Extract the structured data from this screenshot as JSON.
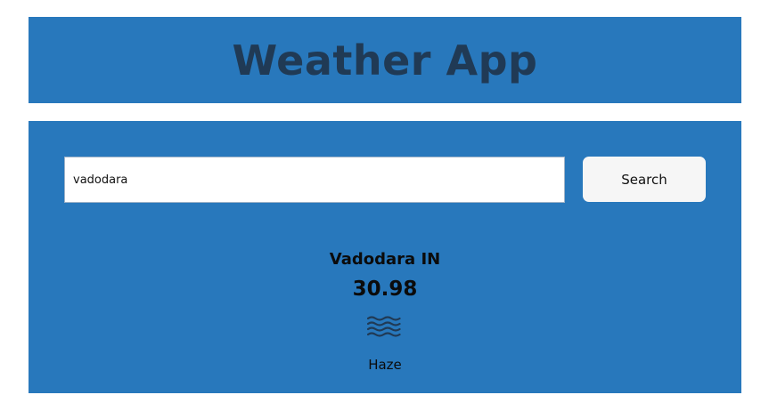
{
  "header": {
    "title": "Weather App"
  },
  "search": {
    "value": "vadodara",
    "button_label": "Search"
  },
  "weather": {
    "city": "Vadodara IN",
    "temperature": "30.98",
    "condition": "Haze",
    "icon": "haze-icon"
  },
  "colors": {
    "panel_background": "#2878bc",
    "title_text": "#203a55",
    "button_background": "#f6f6f6"
  }
}
